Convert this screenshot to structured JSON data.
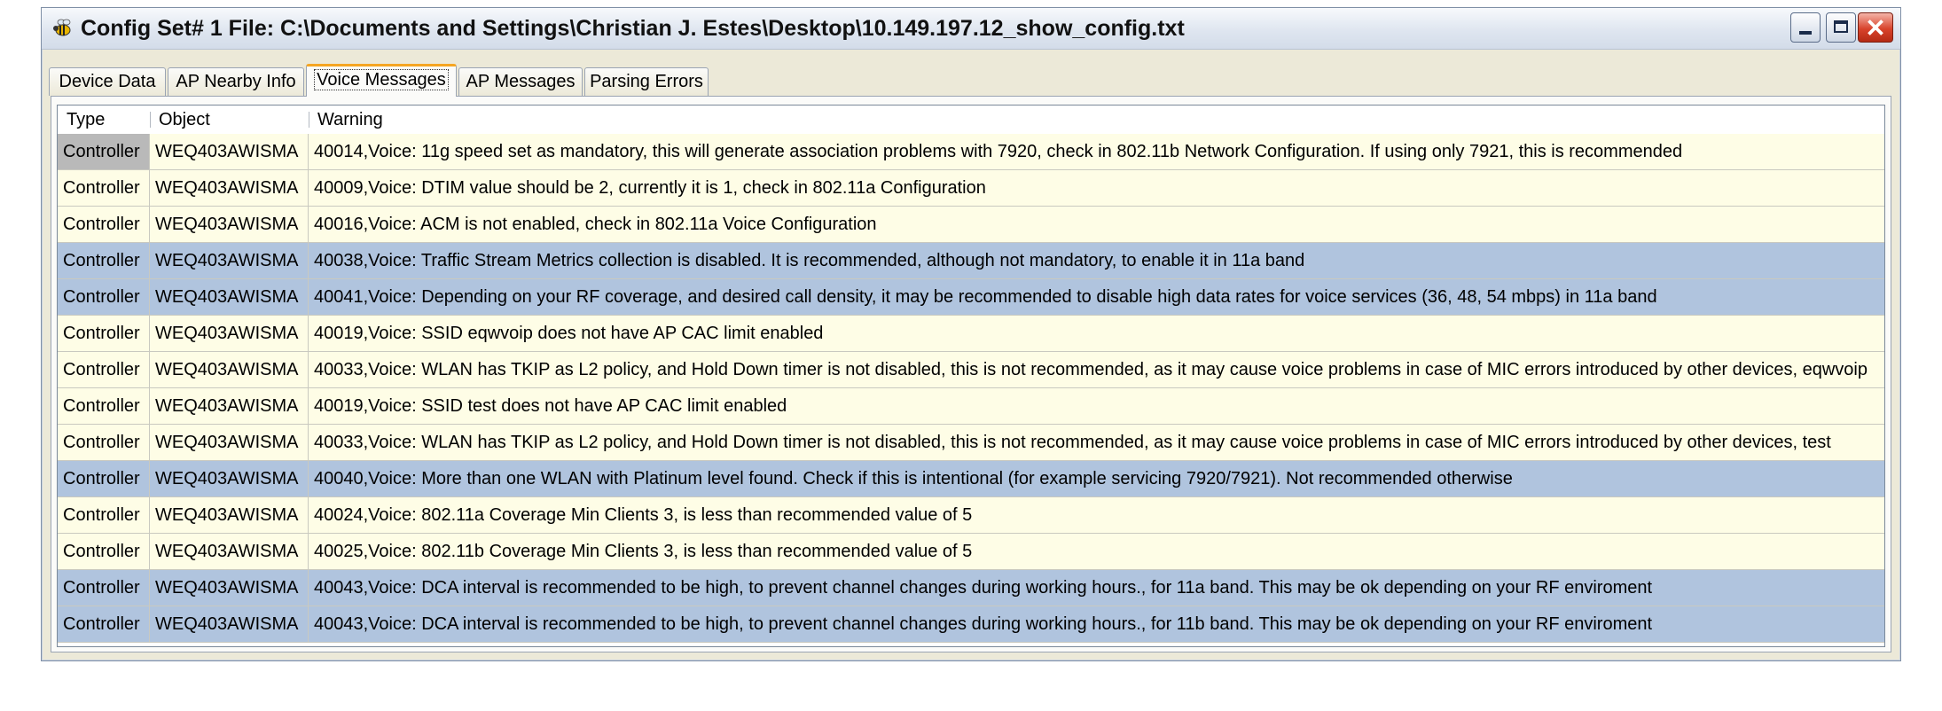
{
  "window": {
    "title": "Config Set# 1 File: C:\\Documents and Settings\\Christian J. Estes\\Desktop\\10.149.197.12_show_config.txt"
  },
  "icons": {
    "app": "bee-icon",
    "minimize": "minimize-icon",
    "maximize": "maximize-icon",
    "close": "close-icon"
  },
  "colors": {
    "row_yellow": "#fefde6",
    "row_blue": "#b0c4de",
    "active_tab_accent": "#f5a623",
    "close_button": "#d8432c"
  },
  "tabs": [
    {
      "label": "Device Data"
    },
    {
      "label": "AP Nearby Info"
    },
    {
      "label": "Voice Messages"
    },
    {
      "label": "AP Messages"
    },
    {
      "label": "Parsing Errors"
    }
  ],
  "active_tab": "Voice Messages",
  "table": {
    "columns": [
      "Type",
      "Object",
      "Warning"
    ],
    "rows": [
      {
        "type": "Controller",
        "object": "WEQ403AWISMA",
        "warning": "40014,Voice: 11g speed set as mandatory, this will generate association problems with 7920, check in 802.11b Network Configuration. If using only 7921, this is recommended",
        "color": "yellow"
      },
      {
        "type": "Controller",
        "object": "WEQ403AWISMA",
        "warning": "40009,Voice: DTIM value should be 2, currently it is 1, check in 802.11a Configuration",
        "color": "yellow"
      },
      {
        "type": "Controller",
        "object": "WEQ403AWISMA",
        "warning": "40016,Voice: ACM is not enabled, check in 802.11a Voice Configuration",
        "color": "yellow"
      },
      {
        "type": "Controller",
        "object": "WEQ403AWISMA",
        "warning": "40038,Voice: Traffic Stream Metrics collection is disabled. It is recommended, although not mandatory, to enable it in 11a band",
        "color": "blue"
      },
      {
        "type": "Controller",
        "object": "WEQ403AWISMA",
        "warning": "40041,Voice: Depending on your RF coverage, and desired call density, it may be recommended to disable high data rates for voice services (36, 48, 54 mbps) in 11a band",
        "color": "blue"
      },
      {
        "type": "Controller",
        "object": "WEQ403AWISMA",
        "warning": "40019,Voice: SSID eqwvoip does not have AP CAC limit enabled",
        "color": "yellow"
      },
      {
        "type": "Controller",
        "object": "WEQ403AWISMA",
        "warning": "40033,Voice: WLAN has TKIP as L2 policy, and Hold Down timer is not disabled, this is not recommended, as it may cause voice problems in case of MIC errors introduced by other devices, eqwvoip",
        "color": "yellow"
      },
      {
        "type": "Controller",
        "object": "WEQ403AWISMA",
        "warning": "40019,Voice: SSID test does not have AP CAC limit enabled",
        "color": "yellow"
      },
      {
        "type": "Controller",
        "object": "WEQ403AWISMA",
        "warning": "40033,Voice: WLAN has TKIP as L2 policy, and Hold Down timer is not disabled, this is not recommended, as it may cause voice problems in case of MIC errors introduced by other devices, test",
        "color": "yellow"
      },
      {
        "type": "Controller",
        "object": "WEQ403AWISMA",
        "warning": "40040,Voice: More than one WLAN with Platinum level found. Check if this is intentional (for example servicing 7920/7921). Not recommended otherwise",
        "color": "blue"
      },
      {
        "type": "Controller",
        "object": "WEQ403AWISMA",
        "warning": "40024,Voice: 802.11a Coverage Min Clients 3,  is less than recommended value of 5",
        "color": "yellow"
      },
      {
        "type": "Controller",
        "object": "WEQ403AWISMA",
        "warning": "40025,Voice: 802.11b Coverage Min Clients 3,  is less than recommended value of 5",
        "color": "yellow"
      },
      {
        "type": "Controller",
        "object": "WEQ403AWISMA",
        "warning": "40043,Voice: DCA interval is recommended to be high, to prevent channel changes during working hours., for 11a band. This may be ok depending on your RF enviroment",
        "color": "blue"
      },
      {
        "type": "Controller",
        "object": "WEQ403AWISMA",
        "warning": "40043,Voice: DCA interval is recommended to be high, to prevent channel changes during working hours., for 11b band. This may be ok depending on your RF enviroment",
        "color": "blue"
      }
    ]
  }
}
